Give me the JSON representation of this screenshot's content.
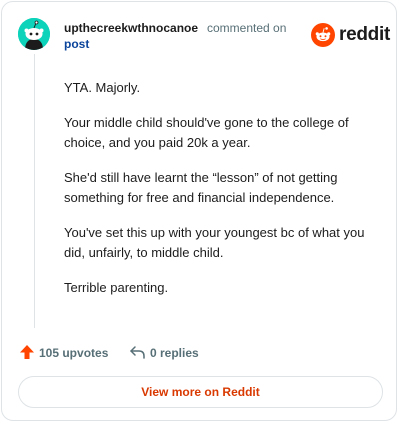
{
  "comment": {
    "username": "upthecreekwthnocanoe",
    "action": "commented on",
    "post_link": "post",
    "paragraphs": [
      "YTA. Majorly.",
      "Your middle child should've gone to the college of choice, and you paid 20k a year.",
      "She'd still have learnt the “lesson” of not getting something for free and financial independence.",
      "You've set this up with your youngest bc of what you did, unfairly, to middle child.",
      "Terrible parenting."
    ],
    "upvotes": "105 upvotes",
    "replies": "0 replies"
  },
  "brand": {
    "name": "reddit",
    "accent_color": "#ff4500",
    "avatar_color": "#0dd3bb"
  },
  "footer": {
    "view_more_label": "View more on Reddit"
  },
  "icons": {
    "avatar": "snoo-avatar-icon",
    "logo": "reddit-logo-icon",
    "upvote": "upvote-arrow-icon",
    "reply": "reply-arrow-icon"
  }
}
